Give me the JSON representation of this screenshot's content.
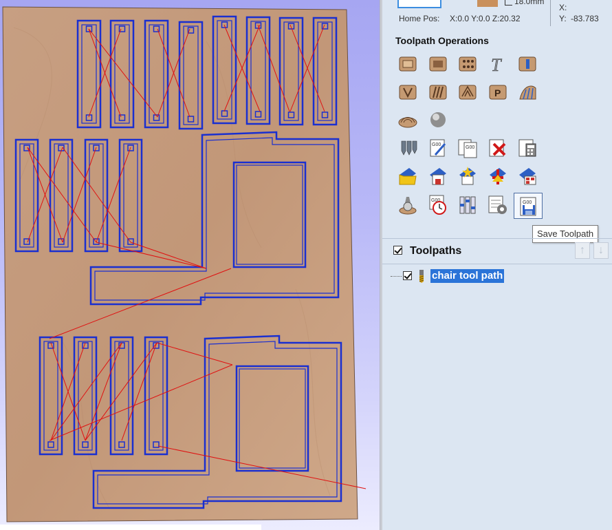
{
  "material": {
    "thickness": "18.0mm"
  },
  "home": {
    "label": "Home Pos:",
    "value": "X:0.0 Y:0.0 Z:20.32"
  },
  "coords": {
    "x_label": "X:",
    "y_label": "Y:",
    "y_value": "-83.783"
  },
  "toolpath_ops": {
    "title": "Toolpath Operations",
    "icons": [
      "profile-icon",
      "pocket-icon",
      "drilling-icon",
      "texture-icon",
      "inlay-icon",
      "v-carve-icon",
      "fluting-icon",
      "prism-icon",
      "texture-toolpath-icon",
      "roughing-icon",
      "finishing-icon",
      "3d-roughing-icon",
      "merge-toolpaths-icon",
      "gcode-edit-icon",
      "gcode-simulate-icon",
      "delete-toolpath-icon",
      "calculate-icon",
      "folder-open-icon",
      "save-folder-icon",
      "recalculate-icon",
      "move-icon",
      "template-icon",
      "tool-database-icon",
      "time-estimate-icon",
      "post-processor-icon",
      "settings-icon",
      "save-toolpath-icon"
    ],
    "tooltip": "Save Toolpath"
  },
  "toolpaths": {
    "title": "Toolpaths",
    "items": [
      {
        "label": "chair tool path",
        "checked": true
      }
    ]
  },
  "colors": {
    "accent": "#2b74d8",
    "wood": "#c59b7d",
    "toolpath": "#1a2fd0",
    "rapid": "#e01010",
    "viewport_bg": "#b3b3f5"
  }
}
